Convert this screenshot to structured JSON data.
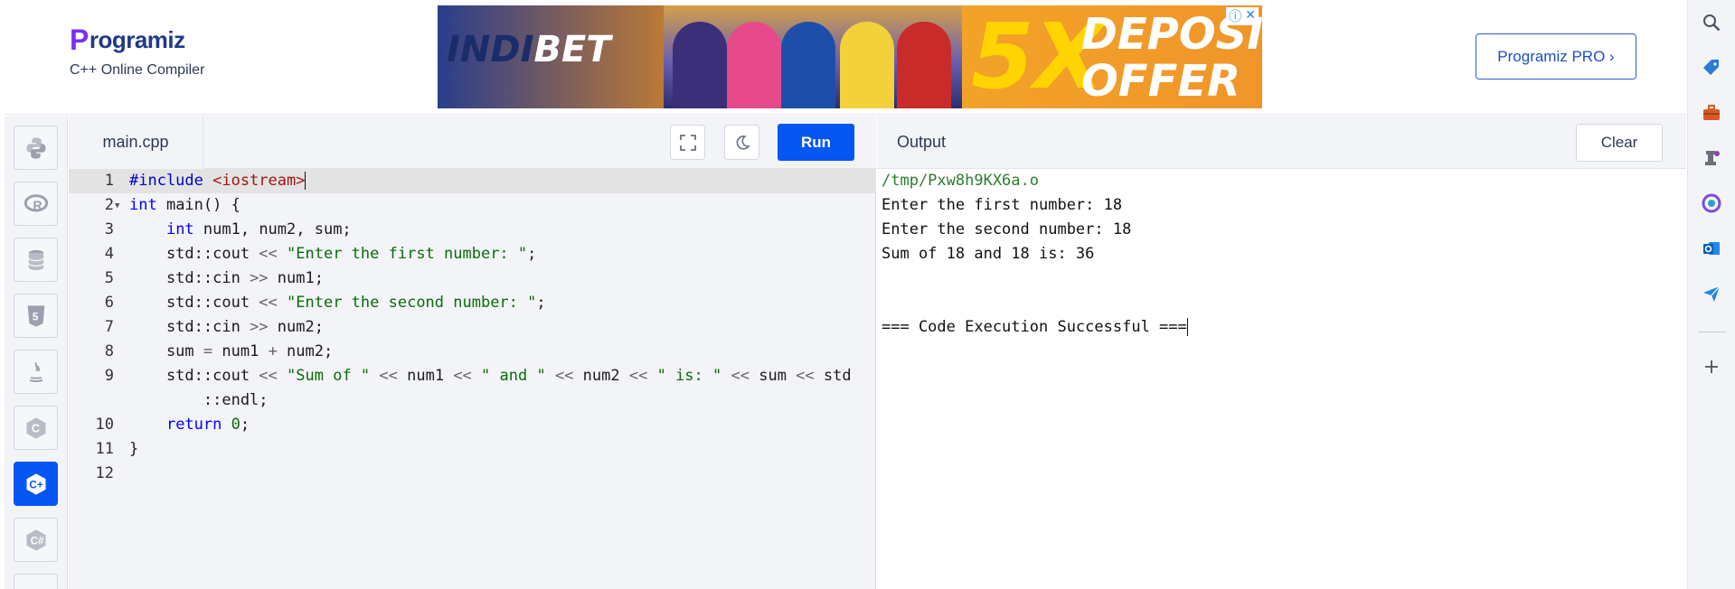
{
  "header": {
    "logo_text": "rogramiz",
    "subtitle": "C++ Online Compiler",
    "pro_button": "Programiz PRO ›",
    "ad": {
      "brand_left": "INDI",
      "brand_right": "BET",
      "big_text": "5X",
      "line1": "DEPOSIT",
      "line2": "OFFER",
      "info_icon": "ⓘ",
      "close_icon": "✕"
    }
  },
  "languages": [
    {
      "name": "python-icon",
      "active": false
    },
    {
      "name": "r-icon",
      "active": false
    },
    {
      "name": "sql-icon",
      "active": false
    },
    {
      "name": "html5-icon",
      "active": false
    },
    {
      "name": "java-icon",
      "active": false
    },
    {
      "name": "c-icon",
      "active": false
    },
    {
      "name": "cpp-icon",
      "active": true
    },
    {
      "name": "csharp-icon",
      "active": false
    }
  ],
  "editor": {
    "file_name": "main.cpp",
    "run_label": "Run",
    "line_numbers": [
      "1",
      "2",
      "3",
      "4",
      "5",
      "6",
      "7",
      "8",
      "9",
      "",
      "10",
      "11",
      "12"
    ]
  },
  "output": {
    "title": "Output",
    "clear_label": "Clear",
    "lines": [
      "/tmp/Pxw8h9KX6a.o",
      "Enter the first number: 18",
      "Enter the second number: 18",
      "Sum of 18 and 18 is: 36",
      "",
      "",
      "=== Code Execution Successful ==="
    ]
  },
  "colors": {
    "accent": "#0556f3",
    "panel": "#f3f4f8",
    "string": "#0a6b0a",
    "keyword": "#0000ff"
  }
}
